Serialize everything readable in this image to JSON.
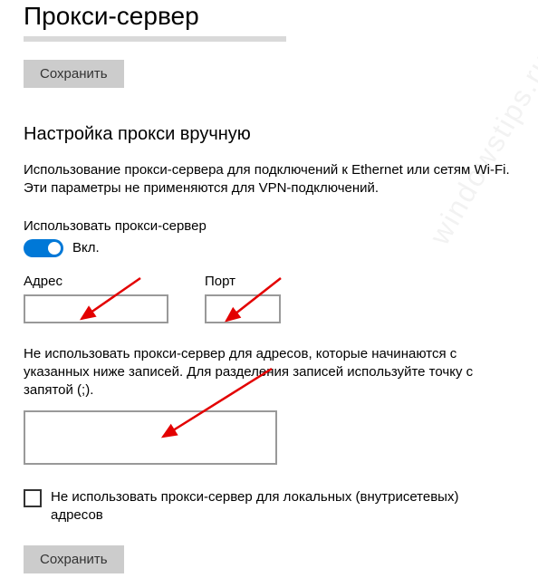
{
  "header": {
    "title": "Прокси-сервер",
    "save_top": "Сохранить"
  },
  "manual": {
    "section_title": "Настройка прокси вручную",
    "description": "Использование прокси-сервера для подключений к Ethernet или сетям Wi-Fi. Эти параметры не применяются для VPN-подключений.",
    "use_proxy_label": "Использовать прокси-сервер",
    "toggle_state": "Вкл.",
    "address_label": "Адрес",
    "address_value": "",
    "port_label": "Порт",
    "port_value": "",
    "exceptions_label": "Не использовать прокси-сервер для адресов, которые начинаются с указанных ниже записей. Для разделения записей используйте точку с запятой (;).",
    "exceptions_value": "",
    "local_checkbox_label": "Не использовать прокси-сервер для локальных (внутрисетевых) адресов",
    "save_bottom": "Сохранить"
  },
  "watermark": "windowstips.ru"
}
